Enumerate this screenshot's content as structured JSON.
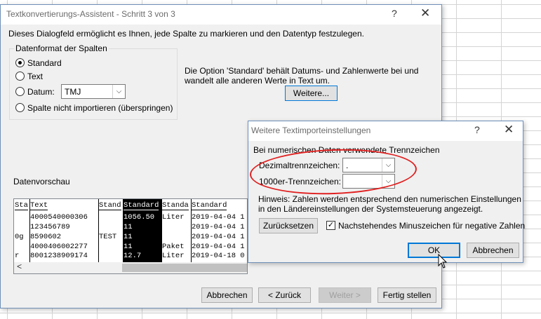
{
  "main": {
    "title": "Textkonvertierungs-Assistent - Schritt 3 von 3",
    "help": "?",
    "close": "✕",
    "description": "Dieses Dialogfeld ermöglicht es Ihnen, jede Spalte zu markieren und den Datentyp festzulegen.",
    "group_label": "Datenformat der Spalten",
    "radio_standard": "Standard",
    "radio_text": "Text",
    "radio_datum": "Datum:",
    "datum_value": "TMJ",
    "radio_skip": "Spalte nicht importieren (überspringen)",
    "info_line1": "Die Option 'Standard' behält Datums- und Zahlenwerte bei und",
    "info_line2": "wandelt alle anderen Werte in Text um.",
    "weitere_button": "Weitere...",
    "preview_label": "Datenvorschau",
    "buttons": {
      "cancel": "Abbrechen",
      "back": "< Zurück",
      "next": "Weiter >",
      "finish": "Fertig stellen"
    }
  },
  "preview": {
    "columns": [
      {
        "header": "Sta",
        "cells": [
          "",
          "",
          "0g",
          "",
          "r"
        ]
      },
      {
        "header": "Text",
        "cells": [
          "4000540000306",
          "123456789",
          "8590602",
          "4000406002277",
          "8001238909174"
        ]
      },
      {
        "header": "Stand",
        "cells": [
          "",
          "",
          "TEST",
          "",
          ""
        ]
      },
      {
        "header": "Standard",
        "cells": [
          "1056.50",
          "11",
          "11",
          "11",
          "12.7"
        ]
      },
      {
        "header": "Standa",
        "cells": [
          "Liter",
          "",
          "",
          "Paket",
          "Liter"
        ]
      },
      {
        "header": "Standard",
        "cells": [
          "2019-04-04 1",
          "2019-04-04 1",
          "2019-04-04 1",
          "2019-04-04 1",
          "2019-04-18 0"
        ]
      }
    ],
    "scroll_left": "<"
  },
  "sub": {
    "title": "Weitere Textimporteinstellungen",
    "help": "?",
    "close": "✕",
    "section": "Bei numerischen Daten verwendete Trennzeichen",
    "decimal_label": "Dezimaltrennzeichen:",
    "decimal_value": ".",
    "thousand_label": "1000er-Trennzeichen:",
    "thousand_value": "",
    "hint_line1": "Hinweis: Zahlen werden entsprechend den numerischen Einstellungen",
    "hint_line2": "in den Ländereinstellungen der Systemsteuerung angezeigt.",
    "reset_button": "Zurücksetzen",
    "minus_label": "Nachstehendes Minuszeichen für negative Zahlen",
    "minus_checked": "✓",
    "ok_button": "OK",
    "cancel_button": "Abbrechen"
  },
  "colors": {
    "annotation": "#e02020",
    "selection": "#000000",
    "focus": "#0078d7"
  }
}
